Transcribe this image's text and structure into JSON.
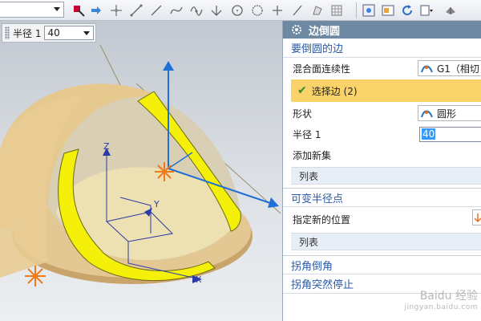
{
  "toolbar": {
    "dropdown_value": "",
    "icons": [
      "snap-icon",
      "arrow-right-icon",
      "move-icon",
      "line-icon",
      "line-segment-icon",
      "spline-icon",
      "wave-icon",
      "point-icon",
      "circle-icon",
      "circle-dotted-icon",
      "cross-icon",
      "slash-icon",
      "shape-icon",
      "grid-icon",
      "view-fit-icon",
      "view-window-icon",
      "refresh-icon",
      "view-dropdown-icon",
      "render-icon"
    ]
  },
  "radius_box": {
    "label": "半径 1",
    "value": "40"
  },
  "viewport": {
    "axes": {
      "x": "X",
      "y": "Y",
      "z": "Z"
    }
  },
  "dialog": {
    "title": "边倒圆",
    "edge_section": {
      "title": "要倒圆的边",
      "blend_label": "混合面连续性",
      "blend_value": "G1（相切",
      "select_edge": "选择边 (2)",
      "shape_label": "形状",
      "shape_value": "圆形",
      "radius_label": "半径 1",
      "radius_value": "40",
      "add_new_set": "添加新集",
      "list_label": "列表"
    },
    "variable_section": {
      "title": "可变半径点",
      "location_label": "指定新的位置",
      "list_label": "列表"
    },
    "corner_section": {
      "title": "拐角倒角"
    },
    "corner_stop_section": {
      "title": "拐角突然停止"
    }
  },
  "watermark": {
    "text": "Baidu 经验",
    "sub": "jingyan.baidu.com"
  },
  "colors": {
    "dialog_title_bg": "#6e8aa3",
    "section_title": "#2a5aa8",
    "selection_bg": "#f9d36a",
    "edge_highlight": "#f5f00a",
    "axis_blue": "#1f6fd6"
  }
}
